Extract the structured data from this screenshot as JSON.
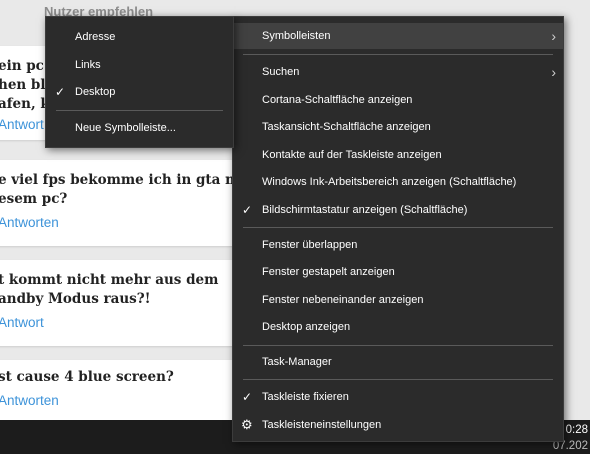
{
  "background": {
    "header": "Nutzer empfehlen",
    "cards": [
      {
        "question": "ein pc s\nhen blac\nafen, ka",
        "answer": "Antwort"
      },
      {
        "question": "e viel fps bekomme ich in gta mit\nesem pc?",
        "answer": "Antworten"
      },
      {
        "question": "t kommt nicht mehr aus dem\nandby Modus raus?!",
        "answer": "Antwort"
      },
      {
        "question": "st cause 4 blue screen?",
        "answer": "Antworten"
      }
    ]
  },
  "clock": {
    "time": "0:28",
    "date": "07.202"
  },
  "submenu": {
    "items": [
      {
        "label": "Adresse",
        "checked": false
      },
      {
        "label": "Links",
        "checked": false
      },
      {
        "label": "Desktop",
        "checked": true
      }
    ],
    "new_toolbar": "Neue Symbolleiste..."
  },
  "menu": {
    "toolbars": "Symbolleisten",
    "search": "Suchen",
    "cortana": "Cortana-Schaltfläche anzeigen",
    "taskview": "Taskansicht-Schaltfläche anzeigen",
    "contacts": "Kontakte auf der Taskleiste anzeigen",
    "ink": "Windows Ink-Arbeitsbereich anzeigen (Schaltfläche)",
    "keyboard": "Bildschirmtastatur anzeigen (Schaltfläche)",
    "cascade": "Fenster überlappen",
    "stacked": "Fenster gestapelt anzeigen",
    "side_by_side": "Fenster nebeneinander anzeigen",
    "show_desktop": "Desktop anzeigen",
    "task_manager": "Task-Manager",
    "lock_taskbar": "Taskleiste fixieren",
    "settings": "Taskleisteneinstellungen"
  },
  "glyphs": {
    "check": "✓",
    "chevron": "›",
    "gear": "⚙"
  }
}
